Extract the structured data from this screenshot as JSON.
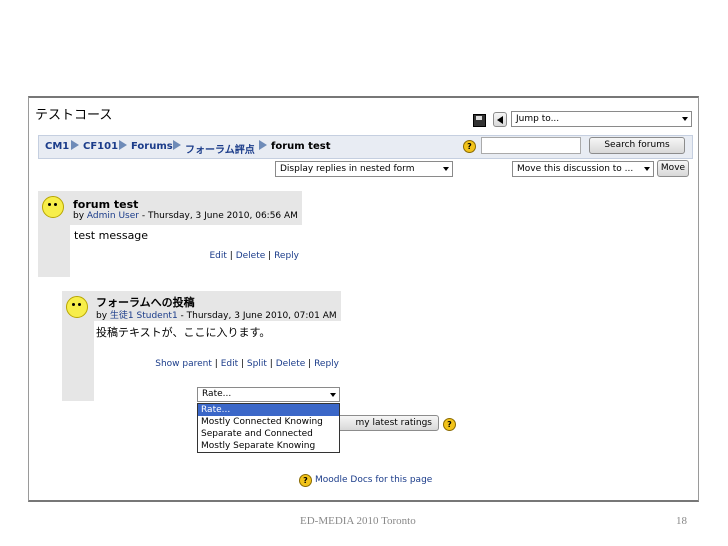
{
  "course": {
    "title": "テストコース"
  },
  "breadcrumb": [
    "CM1",
    "CF101",
    "Forums",
    "フォーラム評点",
    "forum test"
  ],
  "header": {
    "jump_placeholder": "Jump to...",
    "search_button": "Search forums"
  },
  "toolbar": {
    "display_mode": "Display replies in nested form",
    "move_select": "Move this discussion to ...",
    "move_button": "Move"
  },
  "post1": {
    "title": "forum test",
    "by_prefix": "by",
    "author": "Admin User",
    "date": "- Thursday, 3 June 2010, 06:56 AM",
    "message": "test message",
    "cmd_edit": "Edit",
    "cmd_delete": "Delete",
    "cmd_reply": "Reply",
    "sep": "|"
  },
  "post2": {
    "title": "フォーラムへの投稿",
    "by_prefix": "by",
    "author": "生徒1 Student1",
    "date": "- Thursday, 3 June 2010, 07:01 AM",
    "message": "投稿テキストが、ここに入ります。",
    "cmd_show_parent": "Show parent",
    "cmd_edit": "Edit",
    "cmd_split": "Split",
    "cmd_delete": "Delete",
    "cmd_reply": "Reply",
    "sep": "|"
  },
  "rating": {
    "selected": "Rate...",
    "options": [
      "Rate...",
      "Mostly Connected Knowing",
      "Separate and Connected",
      "Mostly Separate Knowing"
    ],
    "send_button": "my latest ratings"
  },
  "docs_link": "Moodle Docs for this page",
  "slide_footer": {
    "event": "ED-MEDIA 2010 Toronto",
    "page": "18"
  },
  "help_glyph": "?",
  "colors": {
    "link": "#1b3c8a",
    "arrow": "#3a9bbf",
    "highlight": "#3b67c8"
  }
}
